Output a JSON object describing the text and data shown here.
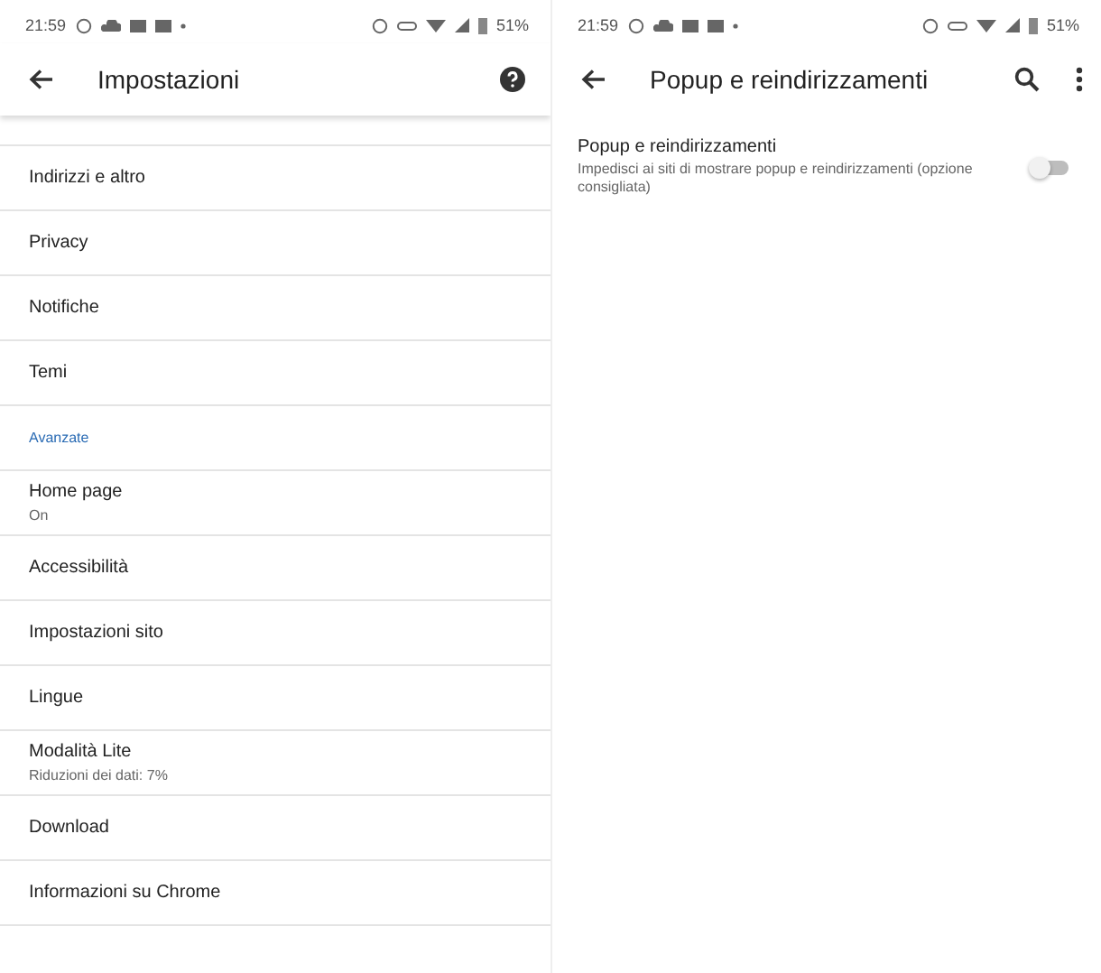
{
  "screens": [
    {
      "status_bar": {
        "time": "21:59",
        "battery": "51%"
      },
      "toolbar": {
        "title": "Impostazioni",
        "actions": [
          {
            "kind": "help"
          }
        ]
      },
      "items": [
        {
          "kind": "clipped"
        },
        {
          "kind": "row",
          "label": "Indirizzi e altro"
        },
        {
          "kind": "row",
          "label": "Privacy"
        },
        {
          "kind": "row",
          "label": "Notifiche"
        },
        {
          "kind": "row",
          "label": "Temi"
        },
        {
          "kind": "header",
          "label": "Avanzate"
        },
        {
          "kind": "row",
          "label": "Home page",
          "summary": "On"
        },
        {
          "kind": "row",
          "label": "Accessibilità"
        },
        {
          "kind": "row",
          "label": "Impostazioni sito"
        },
        {
          "kind": "row",
          "label": "Lingue"
        },
        {
          "kind": "row",
          "label": "Modalità Lite",
          "summary": "Riduzioni dei dati: 7%"
        },
        {
          "kind": "row",
          "label": "Download"
        },
        {
          "kind": "row",
          "label": "Informazioni su Chrome"
        }
      ]
    },
    {
      "status_bar": {
        "time": "21:59",
        "battery": "51%"
      },
      "toolbar": {
        "title": "Popup e reindirizzamenti",
        "actions": [
          {
            "kind": "search"
          },
          {
            "kind": "more"
          }
        ]
      },
      "items": [
        {
          "kind": "switch",
          "label": "Popup e reindirizzamenti",
          "summary": "Impedisci ai siti di mostrare popup e reindirizzamenti (opzione consigliata)",
          "checked": false
        }
      ]
    }
  ]
}
